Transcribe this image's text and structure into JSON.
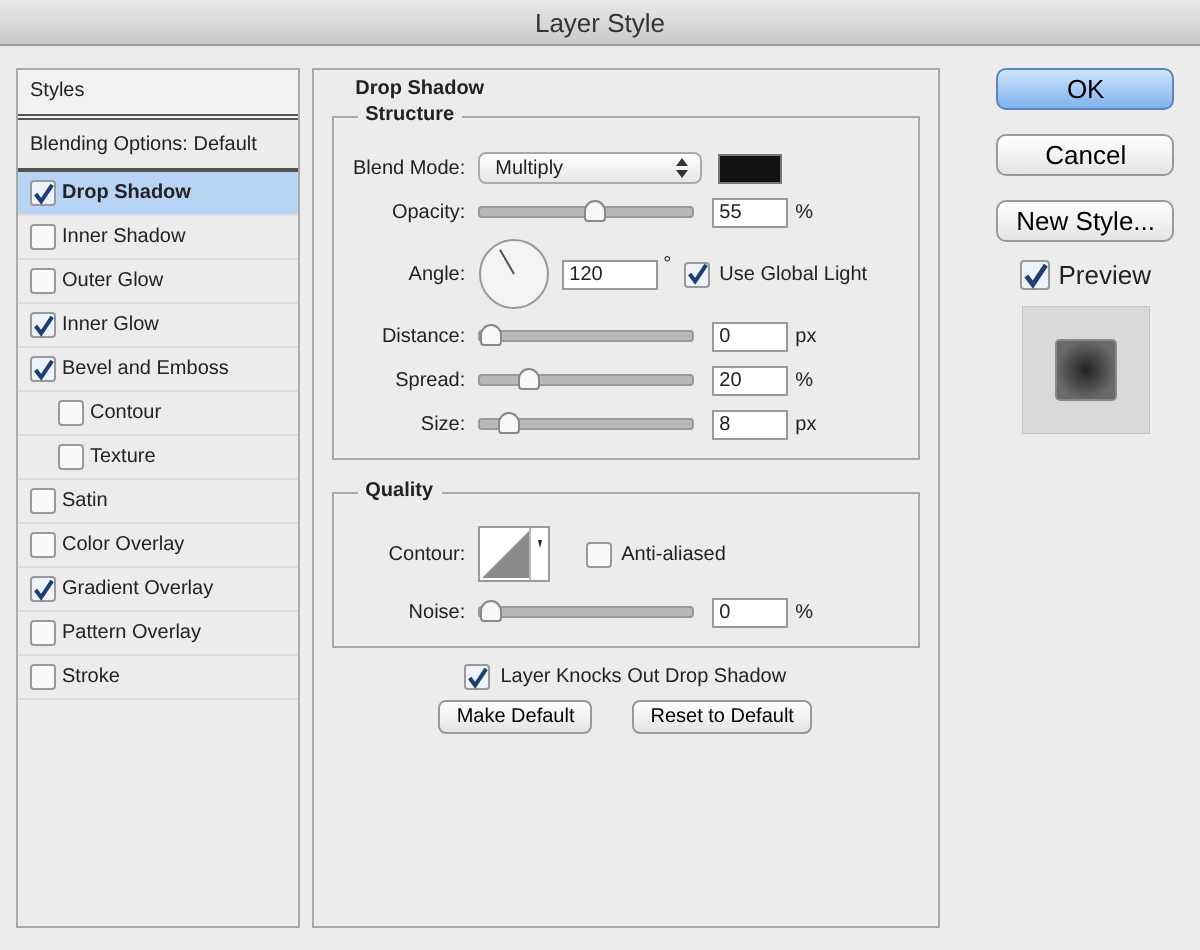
{
  "window": {
    "title": "Layer Style"
  },
  "styles_panel": {
    "header": "Styles",
    "items": [
      {
        "kind": "header",
        "label": "Blending Options: Default",
        "selected": false
      },
      {
        "kind": "checkbox",
        "label": "Drop Shadow",
        "checked": true,
        "selected": true
      },
      {
        "kind": "checkbox",
        "label": "Inner Shadow",
        "checked": false,
        "selected": false
      },
      {
        "kind": "checkbox",
        "label": "Outer Glow",
        "checked": false,
        "selected": false
      },
      {
        "kind": "checkbox",
        "label": "Inner Glow",
        "checked": true,
        "selected": false
      },
      {
        "kind": "checkbox",
        "label": "Bevel and Emboss",
        "checked": true,
        "selected": false,
        "children": [
          {
            "kind": "checkbox",
            "label": "Contour",
            "checked": false,
            "selected": false
          },
          {
            "kind": "checkbox",
            "label": "Texture",
            "checked": false,
            "selected": false
          }
        ]
      },
      {
        "kind": "checkbox",
        "label": "Satin",
        "checked": false,
        "selected": false
      },
      {
        "kind": "checkbox",
        "label": "Color Overlay",
        "checked": false,
        "selected": false
      },
      {
        "kind": "checkbox",
        "label": "Gradient Overlay",
        "checked": true,
        "selected": false
      },
      {
        "kind": "checkbox",
        "label": "Pattern Overlay",
        "checked": false,
        "selected": false
      },
      {
        "kind": "checkbox",
        "label": "Stroke",
        "checked": false,
        "selected": false
      }
    ]
  },
  "drop_shadow": {
    "title": "Drop Shadow",
    "structure": {
      "title": "Structure",
      "blend_mode": {
        "label": "Blend Mode:",
        "value": "Multiply"
      },
      "rows": [
        {
          "kind": "slider",
          "label": "Opacity:",
          "level": 0.55,
          "value": "55",
          "unit": "%"
        },
        {
          "kind": "angle",
          "label": "Angle:",
          "value": "120",
          "unit": "°",
          "use_global_light": {
            "label": "Use Global Light",
            "checked": true
          }
        },
        {
          "kind": "slider",
          "label": "Distance:",
          "level": 0,
          "value": "0",
          "unit": "px"
        },
        {
          "kind": "slider",
          "label": "Spread:",
          "level": 0.2,
          "value": "20",
          "unit": "%"
        },
        {
          "kind": "slider",
          "label": "Size:",
          "level": 0.1,
          "value": "8",
          "unit": "px"
        }
      ]
    },
    "quality": {
      "title": "Quality",
      "contour_label": "Contour:",
      "anti_aliased": {
        "label": "Anti-aliased",
        "checked": false
      },
      "noise": {
        "label": "Noise:",
        "level": 0,
        "value": "0",
        "unit": "%"
      }
    },
    "knockout": {
      "label": "Layer Knocks Out Drop Shadow",
      "checked": true
    },
    "buttons": [
      "Make Default",
      "Reset to Default"
    ]
  },
  "actions": [
    {
      "kind": "default",
      "label": "OK"
    },
    {
      "kind": "normal",
      "label": "Cancel"
    },
    {
      "kind": "normal",
      "label": "New Style..."
    }
  ],
  "preview": {
    "label": "Preview",
    "checked": true
  }
}
